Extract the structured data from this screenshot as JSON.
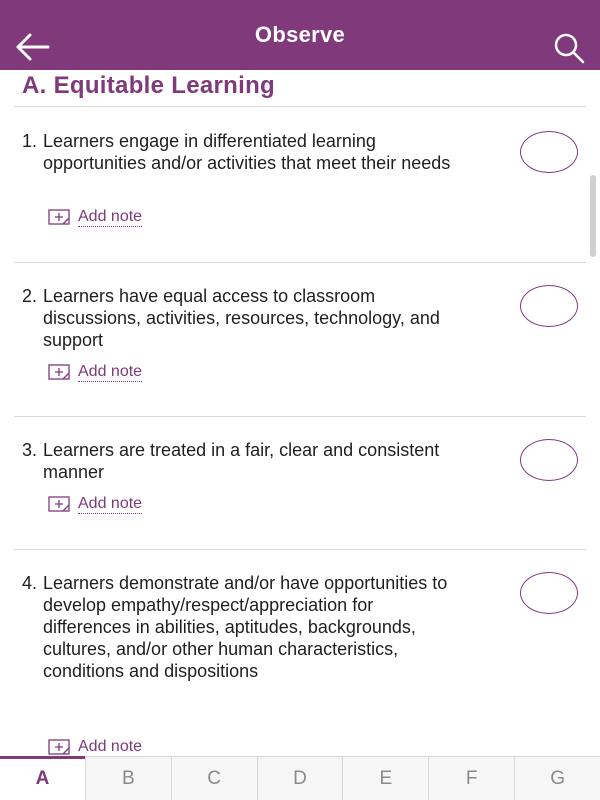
{
  "header": {
    "title": "Observe"
  },
  "section": {
    "title": "A.  Equitable Learning"
  },
  "items": [
    {
      "number": "1.",
      "text": "Learners engage in differentiated learning opportunities and/or activities that meet their needs",
      "note_label": "Add note"
    },
    {
      "number": "2.",
      "text": "Learners have equal access to classroom discussions, activities, resources, technology, and support",
      "note_label": "Add note"
    },
    {
      "number": "3.",
      "text": "Learners are treated in a fair, clear and consistent manner",
      "note_label": "Add note"
    },
    {
      "number": "4.",
      "text": "Learners demonstrate and/or have opportunities to develop empathy/respect/appreciation for differences in abilities, aptitudes, backgrounds, cultures, and/or other human characteristics, conditions and dispositions",
      "note_label": "Add note"
    }
  ],
  "tabs": [
    {
      "label": "A",
      "active": true
    },
    {
      "label": "B",
      "active": false
    },
    {
      "label": "C",
      "active": false
    },
    {
      "label": "D",
      "active": false
    },
    {
      "label": "E",
      "active": false
    },
    {
      "label": "F",
      "active": false
    },
    {
      "label": "G",
      "active": false
    }
  ],
  "icons": {
    "back": "arrow-left-icon",
    "search": "search-icon",
    "note": "add-note-icon"
  },
  "colors": {
    "accent": "#80397b",
    "text": "#1f1f1f",
    "divider": "#dadada"
  }
}
